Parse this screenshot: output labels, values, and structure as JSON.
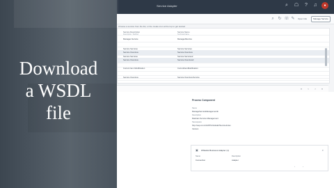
{
  "window": {
    "title": "Service Adapter"
  },
  "toolbar": {
    "open_link": "Open Info",
    "manage_button": "Manage Service"
  },
  "table": {
    "hint": "Choose a service from the list, or the create icon at the top to get started",
    "columns": [
      "Service Description",
      "Service Name"
    ],
    "subheader": [
      "Description / Method",
      "Technical Name"
    ],
    "rows": [
      [
        "Manages Service",
        "ManagedService"
      ],
      [
        "",
        ""
      ],
      [
        "",
        ""
      ],
      [
        "Service Services",
        "Service.Services"
      ],
      [
        "Service Overview",
        "Service.Overview"
      ],
      [
        "Service Services",
        "Service.Services2"
      ],
      [
        "Service Overview",
        "Service.Overview2"
      ],
      [
        "",
        ""
      ],
      [
        "Current Item Modification",
        "CurrentItemModification"
      ],
      [
        "",
        ""
      ],
      [
        "",
        ""
      ],
      [
        "Service Overview",
        "Service.Overview.Service"
      ]
    ]
  },
  "details": {
    "title": "Process Component",
    "fields": [
      {
        "label": "Name",
        "value": "ManageServiceManagementIn"
      },
      {
        "label": "Description",
        "value": "Maintain Service Management"
      },
      {
        "label": "Namespace",
        "value": "http://sap.com/xi/APPL/Global2/ServiceIndex"
      },
      {
        "label": "Version",
        "value": "1"
      }
    ],
    "card": {
      "title": "Whitelist Business Adapter (1)",
      "columns": [
        "Name",
        "Description"
      ],
      "row": [
        "Connection",
        "Adapter"
      ]
    }
  },
  "overlay": {
    "lines": [
      "Download",
      "a WSDL",
      "file"
    ]
  },
  "colors": {
    "topbar": "#2e3947",
    "badge": "#c0392b"
  },
  "icons": [
    "bell-icon",
    "user-icon",
    "grid-icon",
    "close-icon",
    "search-icon",
    "edit-icon",
    "phone-icon",
    "settings-icon"
  ]
}
